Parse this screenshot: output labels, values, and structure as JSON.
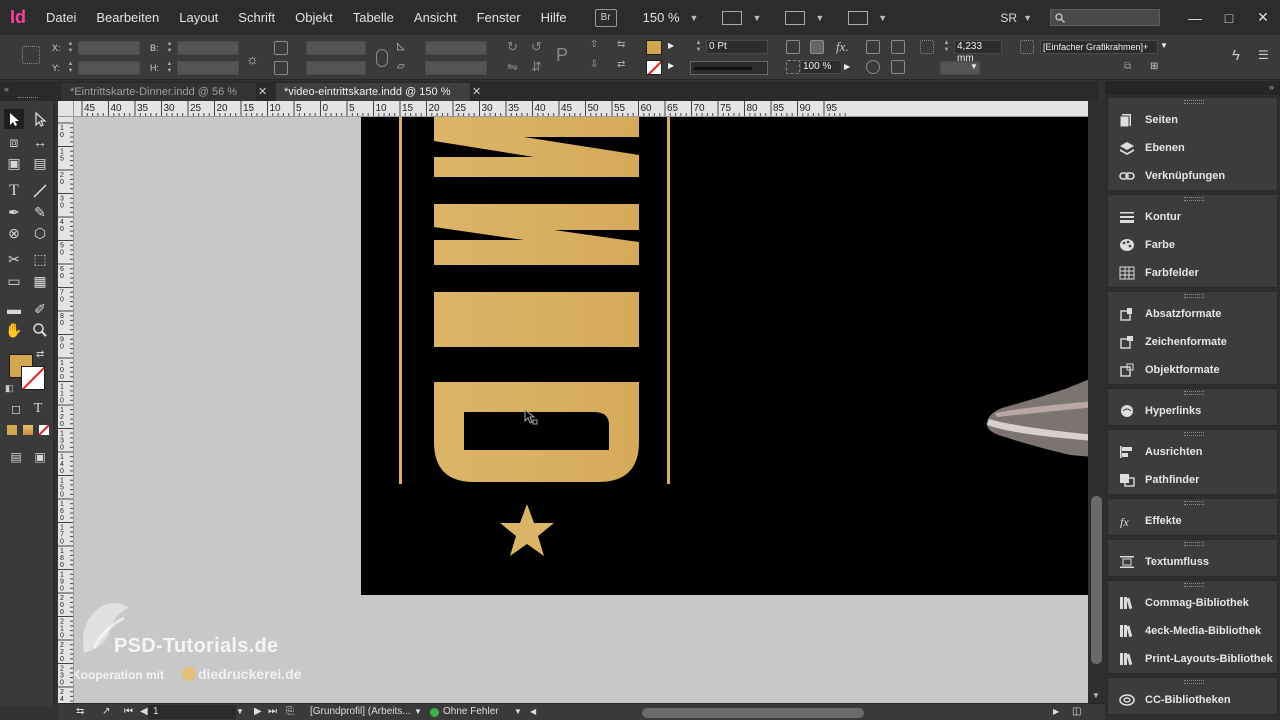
{
  "app": {
    "logo": "Id"
  },
  "menu": {
    "items": [
      "Datei",
      "Bearbeiten",
      "Layout",
      "Schrift",
      "Objekt",
      "Tabelle",
      "Ansicht",
      "Fenster",
      "Hilfe"
    ],
    "bridge": "Br",
    "zoom": "150 %",
    "user": "SR",
    "search_placeholder": "",
    "win_minimize": "—",
    "win_maximize": "□",
    "win_close": "✕"
  },
  "control": {
    "x_label": "X:",
    "y_label": "Y:",
    "w_label": "B:",
    "h_label": "H:",
    "stroke_weight": "0 Pt",
    "opacity": "100 %",
    "offset": "4,233 mm",
    "frame_style": "[Einfacher Grafikrahmen]+"
  },
  "tabs": [
    {
      "label": "*Eintrittskarte-Dinner.indd @ 56 %",
      "active": false
    },
    {
      "label": "*video-eintrittskarte.indd @ 150 %",
      "active": true
    }
  ],
  "ruler": {
    "h_labels": [
      "45",
      "40",
      "35",
      "30",
      "25",
      "20",
      "15",
      "10",
      "5",
      "0",
      "5",
      "10",
      "15",
      "20",
      "25",
      "30",
      "35",
      "40",
      "45",
      "50",
      "55",
      "60",
      "65",
      "70",
      "75",
      "80",
      "85",
      "90",
      "95"
    ],
    "v_labels": [
      "10",
      "15",
      "20",
      "30",
      "40",
      "50",
      "60",
      "70",
      "80",
      "90",
      "100",
      "110",
      "120",
      "130",
      "140",
      "150",
      "160",
      "170",
      "180",
      "190",
      "200",
      "210",
      "220",
      "230",
      "240",
      "250"
    ]
  },
  "canvas": {
    "watermark_title": "PSD-Tutorials.de",
    "watermark_sub": "in Kooperation mit",
    "watermark_brand": "diedruckerei.de",
    "gold": "#d9b062",
    "page_color": "#000000",
    "pasteboard_color": "#c8c8c8"
  },
  "status": {
    "page": "1",
    "profile": "[Grundprofil] (Arbeits...",
    "errors": "Ohne Fehler"
  },
  "panels": {
    "groups": [
      [
        {
          "label": "Seiten",
          "icon": "pages-icon"
        },
        {
          "label": "Ebenen",
          "icon": "layers-icon"
        },
        {
          "label": "Verknüpfungen",
          "icon": "links-icon"
        }
      ],
      [
        {
          "label": "Kontur",
          "icon": "stroke-icon"
        },
        {
          "label": "Farbe",
          "icon": "color-icon"
        },
        {
          "label": "Farbfelder",
          "icon": "swatches-icon"
        }
      ],
      [
        {
          "label": "Absatzformate",
          "icon": "paragraph-styles-icon"
        },
        {
          "label": "Zeichenformate",
          "icon": "character-styles-icon"
        },
        {
          "label": "Objektformate",
          "icon": "object-styles-icon"
        }
      ],
      [
        {
          "label": "Hyperlinks",
          "icon": "hyperlinks-icon"
        }
      ],
      [
        {
          "label": "Ausrichten",
          "icon": "align-icon"
        },
        {
          "label": "Pathfinder",
          "icon": "pathfinder-icon"
        }
      ],
      [
        {
          "label": "Effekte",
          "icon": "effects-icon"
        }
      ],
      [
        {
          "label": "Textumfluss",
          "icon": "text-wrap-icon"
        }
      ],
      [
        {
          "label": "Commag-Bibliothek",
          "icon": "library-icon"
        },
        {
          "label": "4eck-Media-Bibliothek",
          "icon": "library-icon"
        },
        {
          "label": "Print-Layouts-Bibliothek",
          "icon": "library-icon"
        }
      ],
      [
        {
          "label": "CC-Bibliotheken",
          "icon": "cc-libraries-icon"
        }
      ]
    ]
  }
}
